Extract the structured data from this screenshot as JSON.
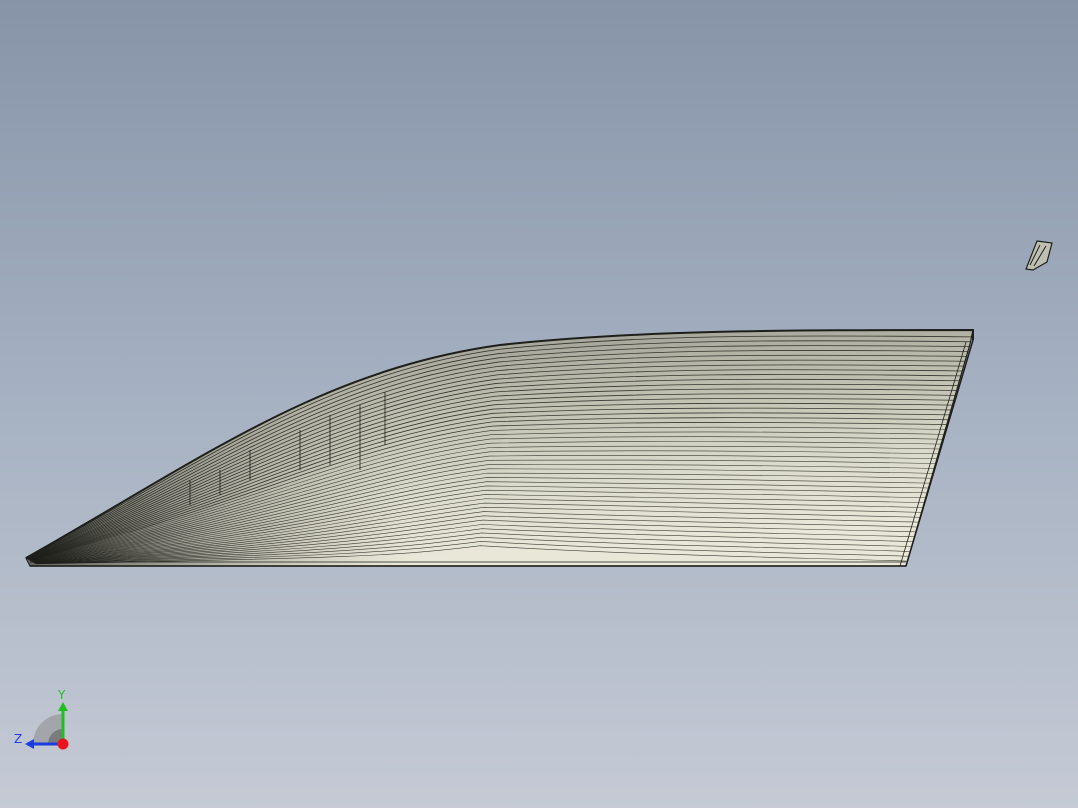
{
  "viewport": {
    "background_top": "#8794a8",
    "background_bottom": "#c5cad5",
    "model_fill_light": "#e6e5d6",
    "model_fill_dark": "#8e8f86",
    "line_color": "#1e1f1a"
  },
  "triad": {
    "x_axis_color": "#e8161c",
    "y_axis_color": "#1fbf1f",
    "z_axis_color": "#1b3de0",
    "y_label": "Y",
    "z_label": "Z"
  }
}
